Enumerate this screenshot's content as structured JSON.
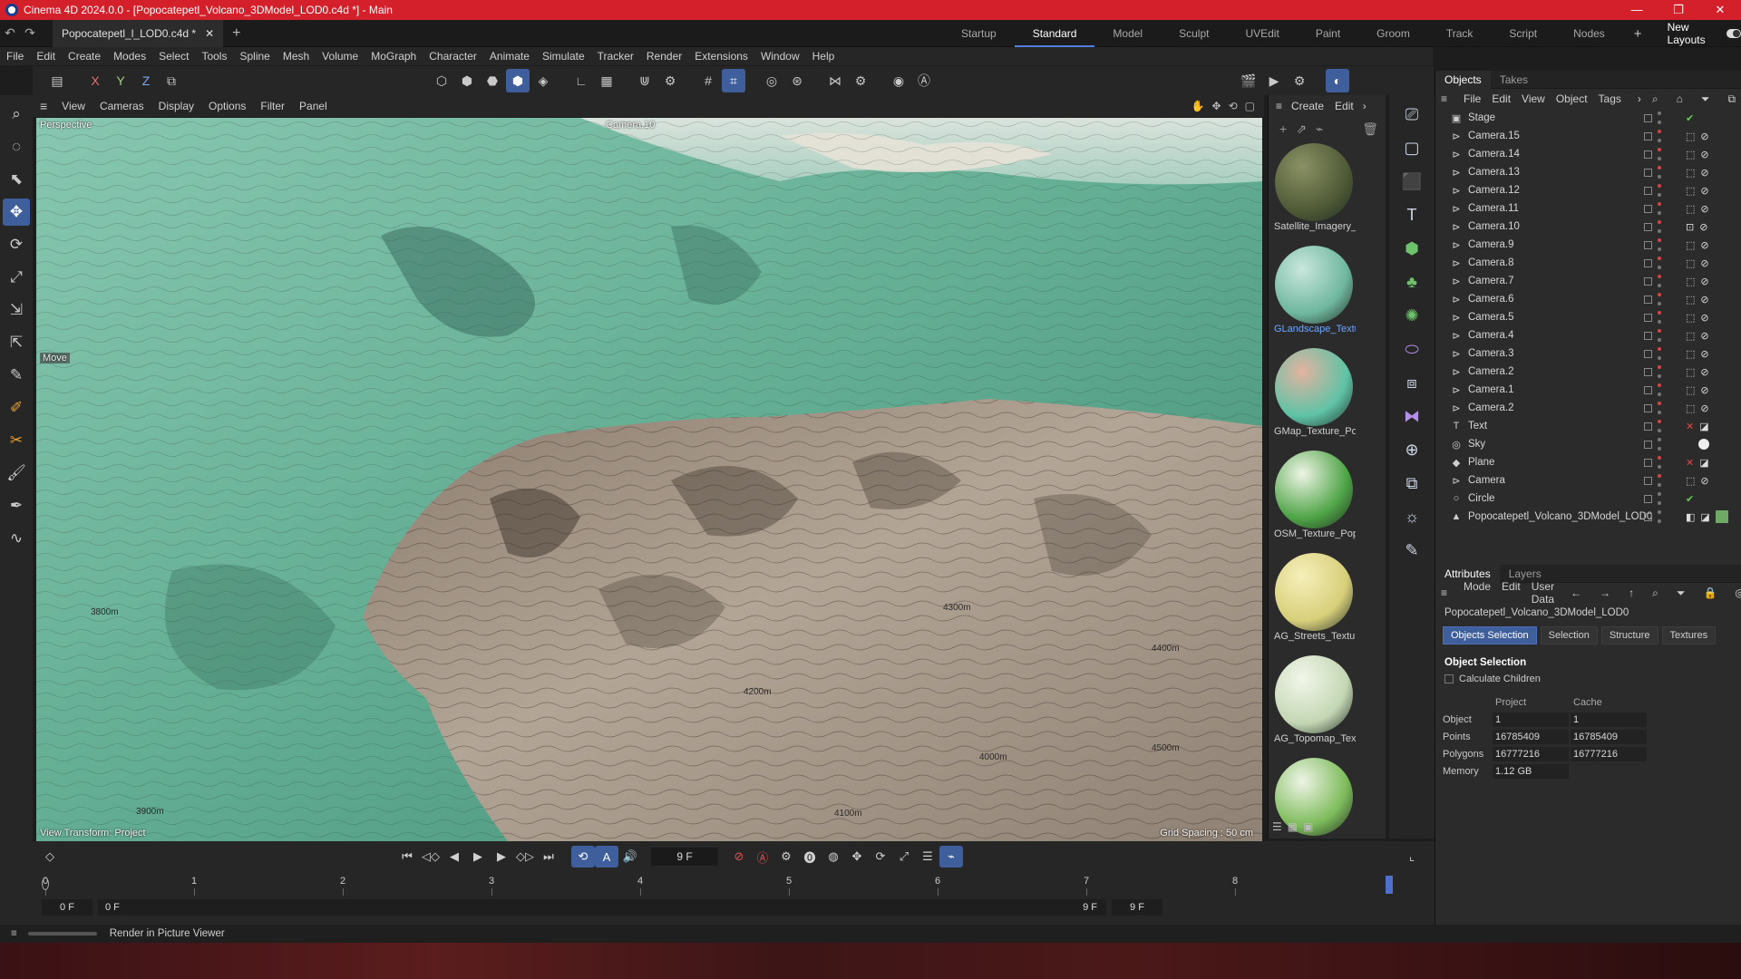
{
  "title": "Cinema 4D 2024.0.0 - [Popocatepetl_Volcano_3DModel_LOD0.c4d *] - Main",
  "doc_tab": "Popocatepetl_l_LOD0.c4d *",
  "layouts": [
    "Startup",
    "Standard",
    "Model",
    "Sculpt",
    "UVEdit",
    "Paint",
    "Groom",
    "Track",
    "Script",
    "Nodes"
  ],
  "active_layout": "Standard",
  "new_layouts": "New Layouts",
  "menu": [
    "File",
    "Edit",
    "Create",
    "Modes",
    "Select",
    "Tools",
    "Spline",
    "Mesh",
    "Volume",
    "MoGraph",
    "Character",
    "Animate",
    "Simulate",
    "Tracker",
    "Render",
    "Extensions",
    "Window",
    "Help"
  ],
  "axis": {
    "x": "X",
    "y": "Y",
    "z": "Z"
  },
  "viewport_menu": [
    "View",
    "Cameras",
    "Display",
    "Options",
    "Filter",
    "Panel"
  ],
  "viewport": {
    "perspective": "Perspective",
    "camera": "Camera.10",
    "move": "Move",
    "view_transform": "View Transform: Project",
    "grid_spacing": "Grid Spacing : 50 cm",
    "contours": [
      "4000m",
      "4100m",
      "4200m",
      "4300m",
      "4400m",
      "4500m",
      "3900m",
      "3800m"
    ]
  },
  "material_menu": [
    "Create",
    "Edit"
  ],
  "materials": [
    {
      "name": "Satellite_Imagery_",
      "color": "#4f5a36",
      "hl": "#8a9164"
    },
    {
      "name": "GLandscape_Textu",
      "color": "#6fb79f",
      "hl": "#c9e7dc",
      "selected": true
    },
    {
      "name": "GMap_Texture_Po",
      "color": "#5fc3a6",
      "hl": "#e2b3a0"
    },
    {
      "name": "OSM_Texture_Pop",
      "color": "#4ea446",
      "hl": "#eef4e6"
    },
    {
      "name": "AG_Streets_Textur",
      "color": "#d8cf7a",
      "hl": "#f5efba"
    },
    {
      "name": "AG_Topomap_Tex",
      "color": "#c4d7b4",
      "hl": "#f2f6ea"
    },
    {
      "name": "",
      "color": "#7dbb5a",
      "hl": "#eef4e6"
    }
  ],
  "objects_tabs": [
    "Objects",
    "Takes"
  ],
  "objects_menu": [
    "File",
    "Edit",
    "View",
    "Object",
    "Tags"
  ],
  "objects": [
    {
      "name": "Stage",
      "icon": "▣",
      "tag": "check"
    },
    {
      "name": "Camera.15",
      "icon": "⊳",
      "tag": "cam"
    },
    {
      "name": "Camera.14",
      "icon": "⊳",
      "tag": "cam"
    },
    {
      "name": "Camera.13",
      "icon": "⊳",
      "tag": "cam"
    },
    {
      "name": "Camera.12",
      "icon": "⊳",
      "tag": "cam"
    },
    {
      "name": "Camera.11",
      "icon": "⊳",
      "tag": "cam"
    },
    {
      "name": "Camera.10",
      "icon": "⊳",
      "tag": "cam-active"
    },
    {
      "name": "Camera.9",
      "icon": "⊳",
      "tag": "cam"
    },
    {
      "name": "Camera.8",
      "icon": "⊳",
      "tag": "cam"
    },
    {
      "name": "Camera.7",
      "icon": "⊳",
      "tag": "cam"
    },
    {
      "name": "Camera.6",
      "icon": "⊳",
      "tag": "cam"
    },
    {
      "name": "Camera.5",
      "icon": "⊳",
      "tag": "cam"
    },
    {
      "name": "Camera.4",
      "icon": "⊳",
      "tag": "cam"
    },
    {
      "name": "Camera.3",
      "icon": "⊳",
      "tag": "cam"
    },
    {
      "name": "Camera.2",
      "icon": "⊳",
      "tag": "cam"
    },
    {
      "name": "Camera.1",
      "icon": "⊳",
      "tag": "cam"
    },
    {
      "name": "Camera.2",
      "icon": "⊳",
      "tag": "cam"
    },
    {
      "name": "Text",
      "icon": "T",
      "tag": "cross"
    },
    {
      "name": "Sky",
      "icon": "◎",
      "tag": "sky"
    },
    {
      "name": "Plane",
      "icon": "◆",
      "tag": "cross"
    },
    {
      "name": "Camera",
      "icon": "⊳",
      "tag": "cam"
    },
    {
      "name": "Circle",
      "icon": "○",
      "tag": "check"
    },
    {
      "name": "Popocatepetl_Volcano_3DModel_LOD0",
      "icon": "▲",
      "tag": "tex"
    }
  ],
  "attr_tabs": [
    "Attributes",
    "Layers"
  ],
  "attr_menu": [
    "Mode",
    "Edit",
    "User Data"
  ],
  "attr_path": "Popocatepetl_Volcano_3DModel_LOD0",
  "attr_buttons": [
    "Objects Selection",
    "Selection",
    "Structure",
    "Textures"
  ],
  "attr_section": "Object Selection",
  "calc_children": "Calculate Children",
  "attr_table": {
    "headers": [
      "Project",
      "Cache"
    ],
    "rows": [
      {
        "k": "Object",
        "p": "1",
        "c": "1"
      },
      {
        "k": "Points",
        "p": "16785409",
        "c": "16785409"
      },
      {
        "k": "Polygons",
        "p": "16777216",
        "c": "16777216"
      },
      {
        "k": "Memory",
        "p": "1.12 GB",
        "c": ""
      }
    ]
  },
  "timeline": {
    "current_frame": "9 F",
    "ticks": [
      "0",
      "1",
      "2",
      "3",
      "4",
      "5",
      "6",
      "7",
      "8"
    ],
    "start": "0 F",
    "start2": "0 F",
    "end": "9 F",
    "end2": "9 F"
  },
  "status": "Render in Picture Viewer"
}
